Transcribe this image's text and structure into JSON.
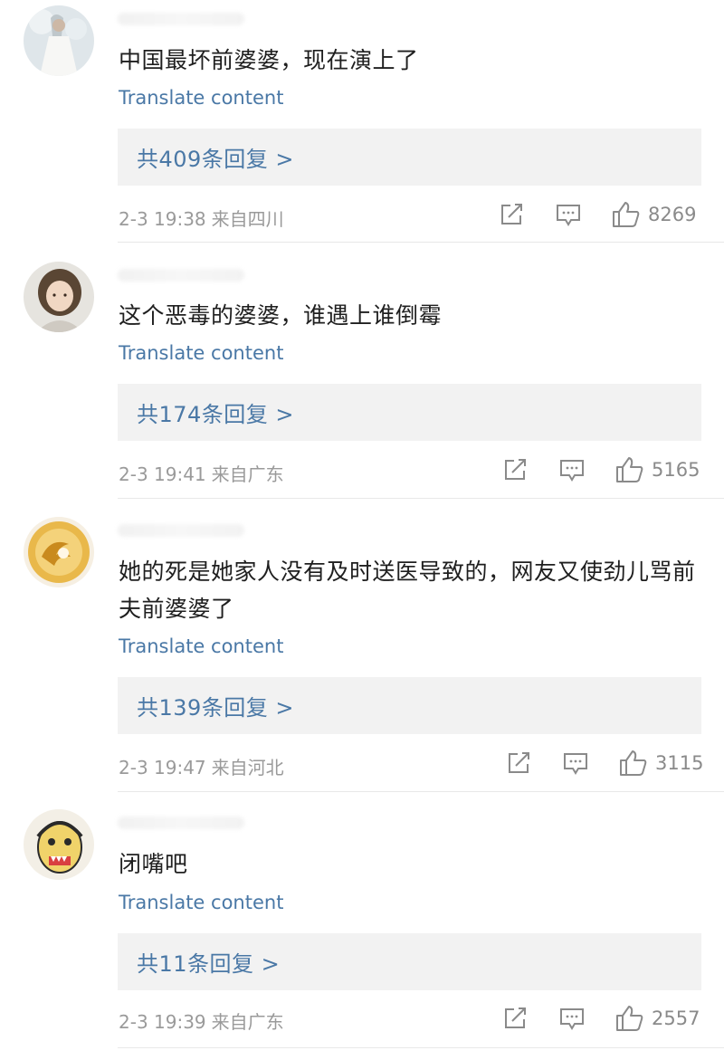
{
  "colors": {
    "link": "#4a78a6",
    "text": "#1f1f1f",
    "meta": "#9a9a9a",
    "reply_bg": "#f2f2f2"
  },
  "comments": [
    {
      "text": "中国最坏前婆婆，现在演上了",
      "translate": "Translate content",
      "replies": "共409条回复 >",
      "time": "2-3 19:38",
      "region": "来自四川",
      "likes": "8269",
      "avatar_icon": "woman-in-white-dress-avatar"
    },
    {
      "text": "这个恶毒的婆婆，谁遇上谁倒霉",
      "translate": "Translate content",
      "replies": "共174条回复 >",
      "time": "2-3 19:41",
      "region": "来自广东",
      "likes": "5165",
      "avatar_icon": "child-photo-avatar"
    },
    {
      "text": "她的死是她家人没有及时送医导致的，网友又使劲儿骂前夫前婆婆了",
      "translate": "Translate content",
      "replies": "共139条回复 >",
      "time": "2-3 19:47",
      "region": "来自河北",
      "likes": "3115",
      "avatar_icon": "golden-swirl-avatar"
    },
    {
      "text": "闭嘴吧",
      "translate": "Translate content",
      "replies": "共11条回复 >",
      "time": "2-3 19:39",
      "region": "来自广东",
      "likes": "2557",
      "avatar_icon": "drawn-face-avatar"
    }
  ],
  "icons": {
    "share": "share-icon",
    "reply": "comment-icon",
    "like": "thumbs-up-icon"
  }
}
